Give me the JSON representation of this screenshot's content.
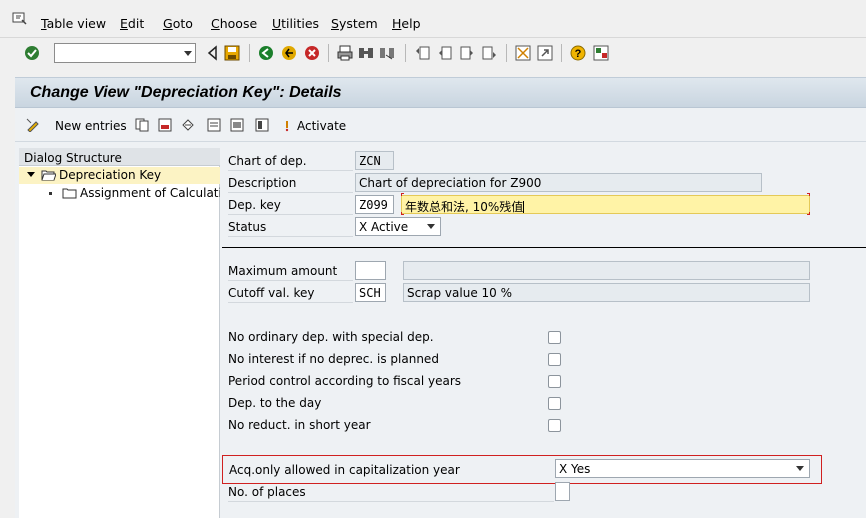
{
  "menu": {
    "items": [
      "Table view",
      "Edit",
      "Goto",
      "Choose",
      "Utilities",
      "System",
      "Help"
    ]
  },
  "toolbar": {
    "command_value": "",
    "icons": [
      "enter-icon",
      "back-icon",
      "save-icon",
      "green-back-icon",
      "exit-icon",
      "cancel-icon",
      "print-icon",
      "find-icon",
      "find-next-icon",
      "first-page-icon",
      "previous-page-icon",
      "next-page-icon",
      "last-page-icon",
      "create-session-icon",
      "shortcut-icon",
      "help-icon",
      "layout-icon"
    ]
  },
  "title": "Change View \"Depreciation Key\": Details",
  "app_toolbar": {
    "new_entries": "New entries",
    "activate": "Activate"
  },
  "dialog_structure": {
    "header": "Dialog Structure",
    "items": [
      {
        "label": "Depreciation Key",
        "selected": true
      },
      {
        "label": "Assignment of Calculation",
        "selected": false
      }
    ]
  },
  "form": {
    "chart_of_dep": {
      "label": "Chart of dep.",
      "value": "ZCN"
    },
    "description": {
      "label": "Description",
      "value": "Chart of depreciation for Z900"
    },
    "dep_key": {
      "label": "Dep. key",
      "value": "Z099",
      "text": "年数总和法, 10%残值"
    },
    "status": {
      "label": "Status",
      "value": "X Active"
    },
    "maximum_amount": {
      "label": "Maximum amount",
      "value": "",
      "text": ""
    },
    "cutoff_val_key": {
      "label": "Cutoff val. key",
      "value": "SCH",
      "text": "Scrap value 10 %"
    },
    "checkboxes": [
      {
        "label": "No ordinary dep. with special dep.",
        "checked": false
      },
      {
        "label": "No interest if no deprec. is planned",
        "checked": false
      },
      {
        "label": "Period control according to fiscal years",
        "checked": false
      },
      {
        "label": "Dep. to the day",
        "checked": false
      },
      {
        "label": "No reduct. in short year",
        "checked": false
      }
    ],
    "acq_only": {
      "label": "Acq.only allowed in capitalization year",
      "value": "X Yes"
    },
    "no_of_places": {
      "label": "No. of places",
      "value": ""
    }
  },
  "colors": {
    "title_bg": "#c9d5e0",
    "highlight_field": "#fff3a6",
    "selected_tree": "#fcf3c4",
    "red_frame": "#d02020"
  }
}
